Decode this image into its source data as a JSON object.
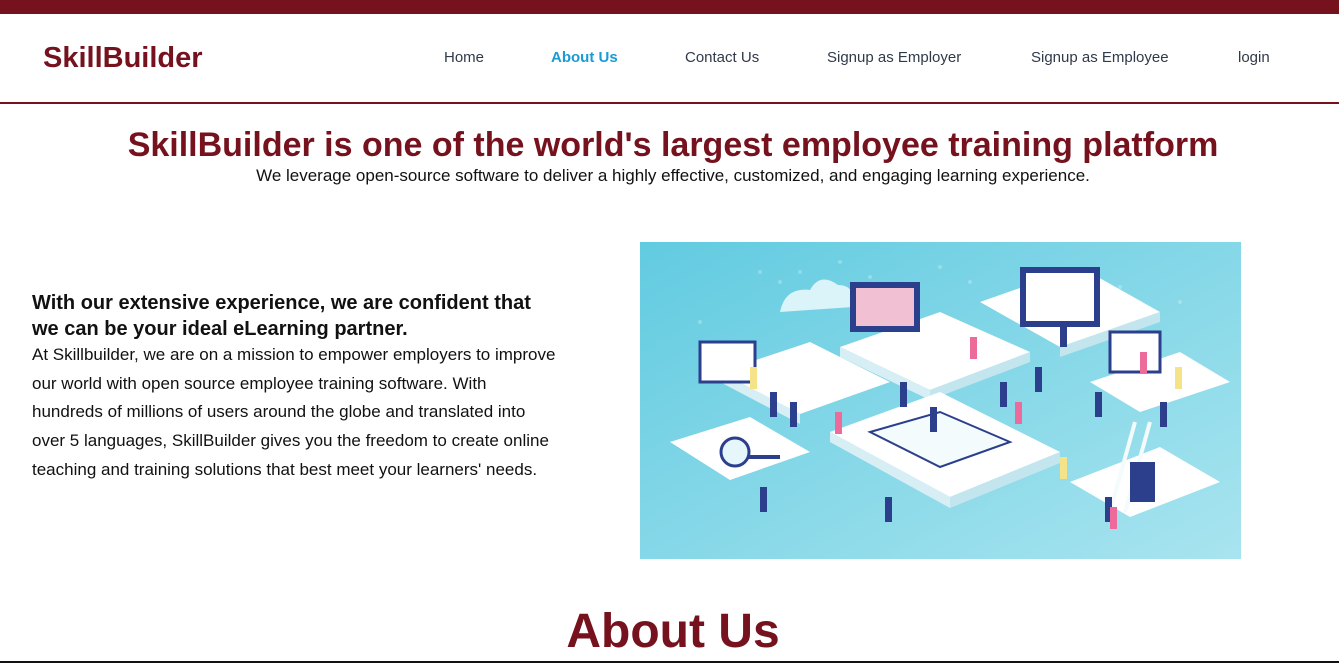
{
  "navbar": {
    "brand": "SkillBuilder",
    "links": [
      {
        "label": "Home"
      },
      {
        "label": "About Us",
        "active": true
      },
      {
        "label": "Contact Us"
      },
      {
        "label": "Signup as Employer"
      },
      {
        "label": "Signup as Employee"
      },
      {
        "label": "login"
      }
    ]
  },
  "hero": {
    "title": "SkillBuilder is one of the world's largest employee training platform",
    "subtitle": "We leverage open-source software to deliver a highly effective, customized, and engaging learning experience."
  },
  "intro": {
    "heading": "With our extensive experience, we are confident that we can be your ideal eLearning partner.",
    "body": "At Skillbuilder, we are on a mission to empower employers to improve our world with open source employee training software. With hundreds of millions of users around the globe and translated into over 5 languages, SkillBuilder gives you the freedom to create online teaching and training solutions that best meet your learners' needs."
  },
  "about": {
    "title": "About Us"
  },
  "colors": {
    "brand": "#75121e",
    "active_link": "#1a9ad6",
    "nav_text": "#2f3a4a",
    "illustration_bg": "#5cc6dc"
  },
  "icons": {
    "illustration": "isometric-elearning-illustration"
  }
}
